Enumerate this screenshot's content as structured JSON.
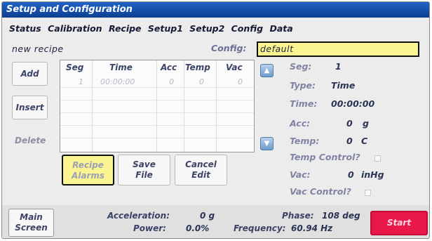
{
  "title": "Setup and Configuration",
  "menu": [
    "Status",
    "Calibration",
    "Recipe",
    "Setup1",
    "Setup2",
    "Config",
    "Data"
  ],
  "recipe": {
    "name": "new recipe"
  },
  "config": {
    "label": "Config:",
    "value": "default"
  },
  "side_buttons": {
    "add": "Add",
    "insert": "Insert",
    "delete": "Delete"
  },
  "table": {
    "headers": [
      "Seg",
      "Time",
      "Acc",
      "Temp",
      "Vac"
    ],
    "rows": [
      {
        "seg": "1",
        "time": "00:00:00",
        "acc": "0",
        "temp": "0",
        "vac": "0"
      }
    ]
  },
  "buttons": {
    "alarms_l1": "Recipe",
    "alarms_l2": "Alarms",
    "save_l1": "Save",
    "save_l2": "File",
    "cancel_l1": "Cancel",
    "cancel_l2": "Edit"
  },
  "params": {
    "seg_label": "Seg:",
    "seg_value": "1",
    "type_label": "Type:",
    "type_value": "Time",
    "time_label": "Time:",
    "time_value": "00:00:00",
    "acc_label": "Acc:",
    "acc_value": "0",
    "acc_unit": "g",
    "temp_label": "Temp:",
    "temp_value": "0",
    "temp_unit": "C",
    "temp_control_label": "Temp Control?",
    "vac_label": "Vac:",
    "vac_value": "0",
    "vac_unit": "inHg",
    "vac_control_label": "Vac Control?"
  },
  "status": {
    "main_l1": "Main",
    "main_l2": "Screen",
    "acceleration_label": "Acceleration:",
    "acceleration_value": "0 g",
    "power_label": "Power:",
    "power_value": "0.0%",
    "phase_label": "Phase:",
    "phase_value": "108 deg",
    "frequency_label": "Frequency:",
    "frequency_value": "60.94 Hz",
    "start_label": "Start"
  },
  "colors": {
    "titlebar": "#0d3f92",
    "highlight": "#fbf591",
    "start": "#e8184a",
    "arrow": "#6e9acc"
  },
  "icons": {
    "up": "arrow-up-icon",
    "down": "arrow-down-icon"
  }
}
